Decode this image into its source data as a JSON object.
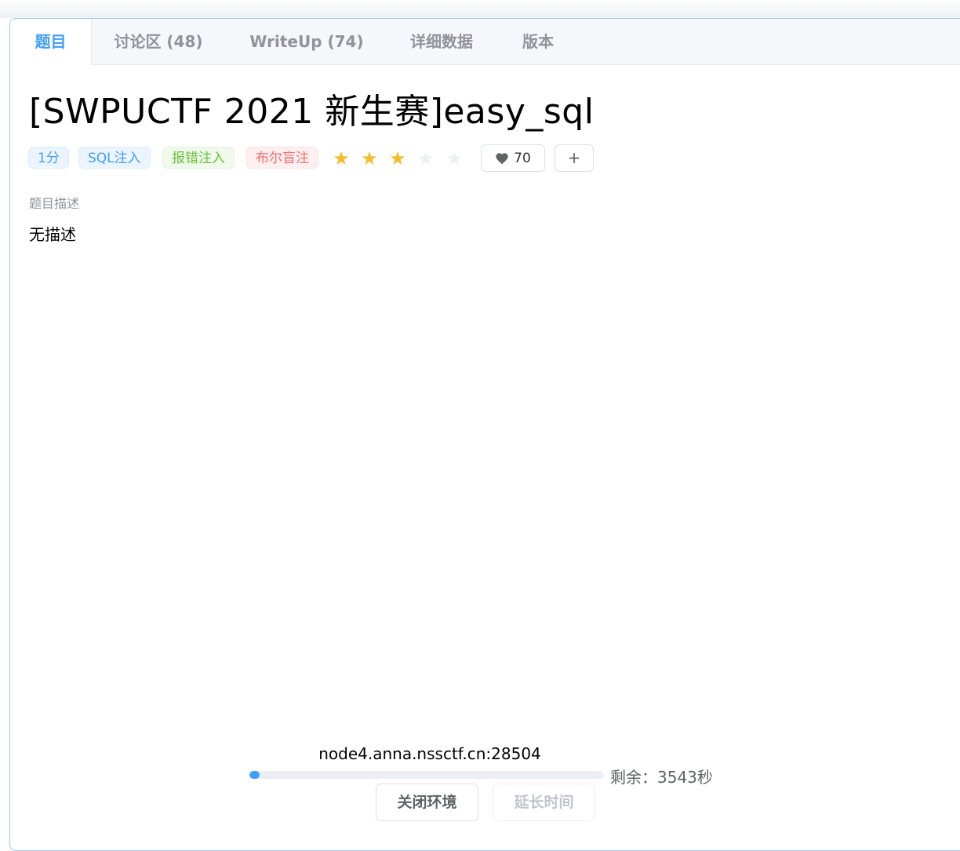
{
  "tabs": [
    {
      "label": "题目",
      "active": true
    },
    {
      "label": "讨论区 (48)",
      "active": false
    },
    {
      "label": "WriteUp (74)",
      "active": false
    },
    {
      "label": "详细数据",
      "active": false
    },
    {
      "label": "版本",
      "active": false
    }
  ],
  "problem": {
    "title": "[SWPUCTF 2021 新生赛]easy_sql",
    "tags": [
      {
        "label": "1分",
        "color": "blue"
      },
      {
        "label": "SQL注入",
        "color": "blue"
      },
      {
        "label": "报错注入",
        "color": "green"
      },
      {
        "label": "布尔盲注",
        "color": "red"
      }
    ],
    "rating": {
      "value": 3,
      "max": 5
    },
    "likes": "70",
    "like_icon": "heart-icon",
    "plus_label": "+",
    "description_label": "题目描述",
    "description": "无描述"
  },
  "environment": {
    "host": "node4.anna.nssctf.cn:28504",
    "remaining_label": "剩余：3543秒",
    "progress_fraction": 0.015,
    "close_label": "关闭环境",
    "extend_label": "延长时间"
  },
  "colors": {
    "accent": "#409eff",
    "star_on": "#f7ba2a",
    "tag_green": "#67c23a",
    "tag_red": "#f56c6c"
  }
}
